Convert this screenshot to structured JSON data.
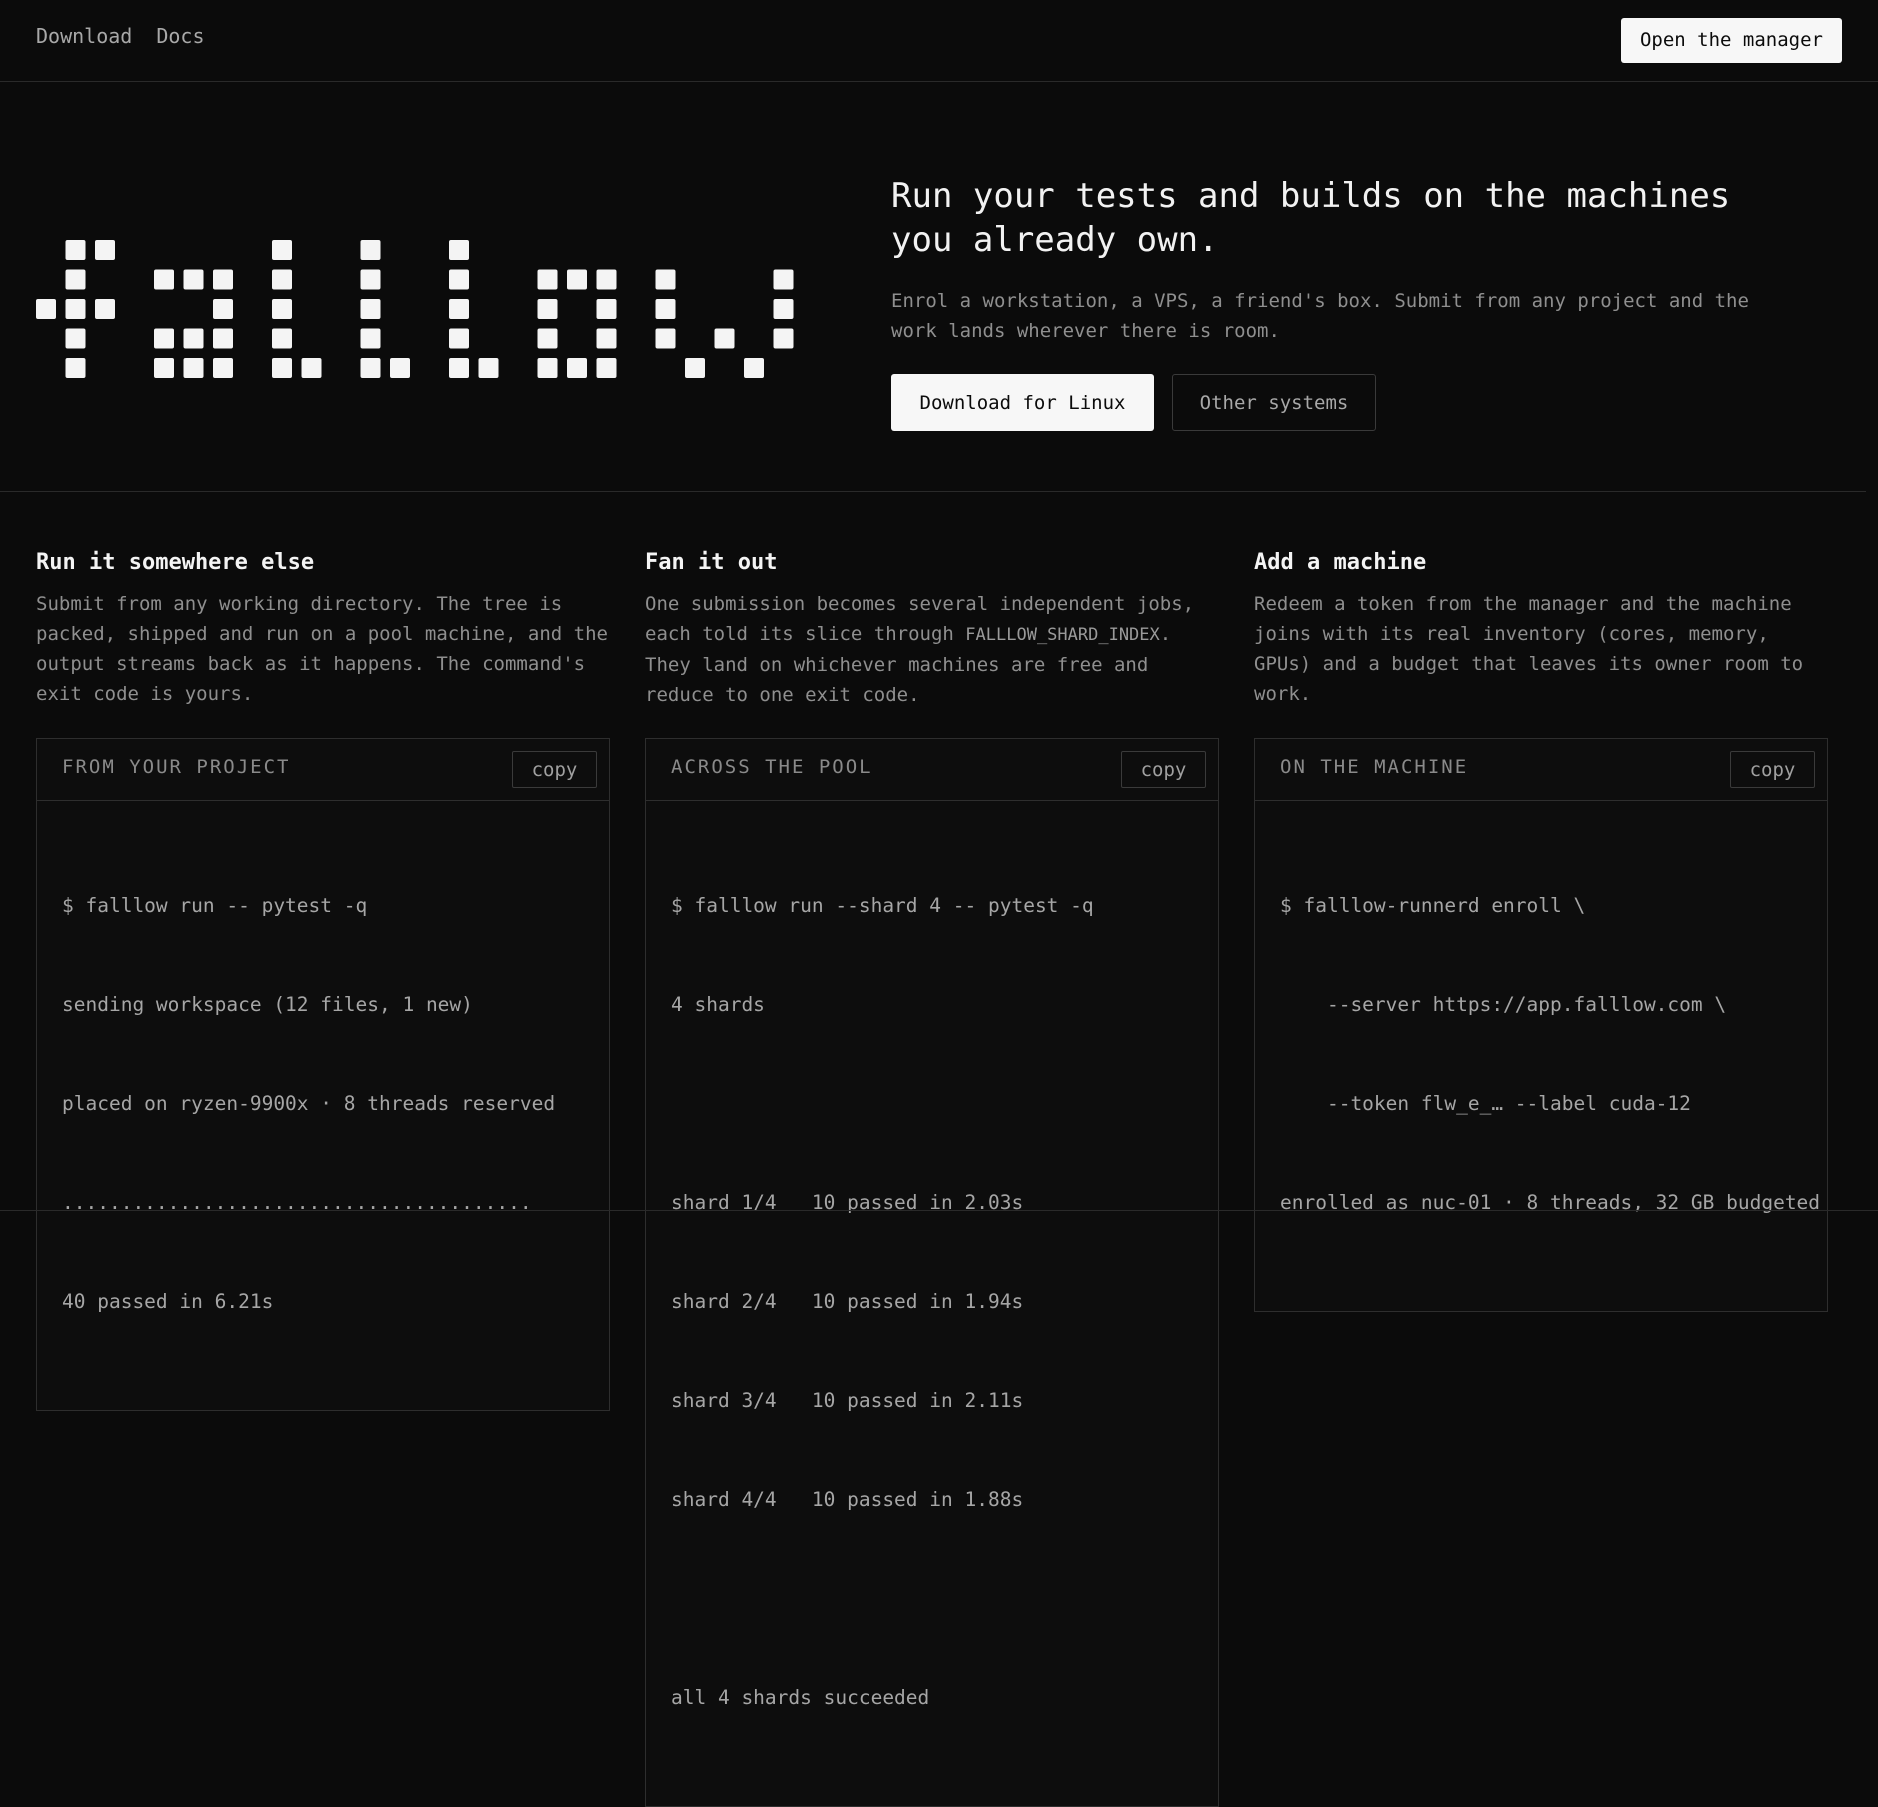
{
  "nav": {
    "links": [
      "Download",
      "Docs"
    ],
    "manager_button": "Open the manager"
  },
  "hero": {
    "logo_alt": "falllow",
    "headline": "Run your tests and builds on the machines you already own.",
    "subline": "Enrol a workstation, a VPS, a friend's box. Submit from any project and the work lands wherever there is room.",
    "primary_button": "Download for Linux",
    "secondary_button": "Other systems"
  },
  "features": [
    {
      "title": "Run it somewhere else",
      "text_before": "Submit from any working directory. The tree is packed, shipped and run on a pool machine, and the output streams back as it happens. The command's exit code is yours.",
      "code": "",
      "text_after": "",
      "terminal": {
        "title": "FROM YOUR PROJECT",
        "copy_label": "copy",
        "lines": [
          "$ falllow run -- pytest -q",
          "sending workspace (12 files, 1 new)",
          "placed on ryzen-9900x · 8 threads reserved",
          "........................................",
          "40 passed in 6.21s"
        ]
      }
    },
    {
      "title": "Fan it out",
      "text_before": "One submission becomes several independent jobs, each told its slice through ",
      "code": "FALLLOW_SHARD_INDEX",
      "text_after": ". They land on whichever machines are free and reduce to one exit code.",
      "terminal": {
        "title": "ACROSS THE POOL",
        "copy_label": "copy",
        "lines": [
          "$ falllow run --shard 4 -- pytest -q",
          "4 shards",
          "",
          "shard 1/4   10 passed in 2.03s",
          "shard 2/4   10 passed in 1.94s",
          "shard 3/4   10 passed in 2.11s",
          "shard 4/4   10 passed in 1.88s",
          "",
          "all 4 shards succeeded"
        ]
      }
    },
    {
      "title": "Add a machine",
      "text_before": "Redeem a token from the manager and the machine joins with its real inventory (cores, memory, GPUs) and a budget that leaves its owner room to work.",
      "code": "",
      "text_after": "",
      "terminal": {
        "title": "ON THE MACHINE",
        "copy_label": "copy",
        "lines": [
          "$ falllow-runnerd enroll \\",
          "    --server https://app.falllow.com \\",
          "    --token flw_e_… --label cuda-12",
          "enrolled as nuc-01 · 8 threads, 32 GB budgeted"
        ]
      }
    }
  ],
  "colors": {
    "background": "#0b0b0b",
    "text": "#f2f2f2",
    "muted": "#8f8f8f",
    "border": "#2e2e2e",
    "button_light": "#f7f7f7"
  },
  "icons": {
    "logo": "pixel-wordmark"
  }
}
